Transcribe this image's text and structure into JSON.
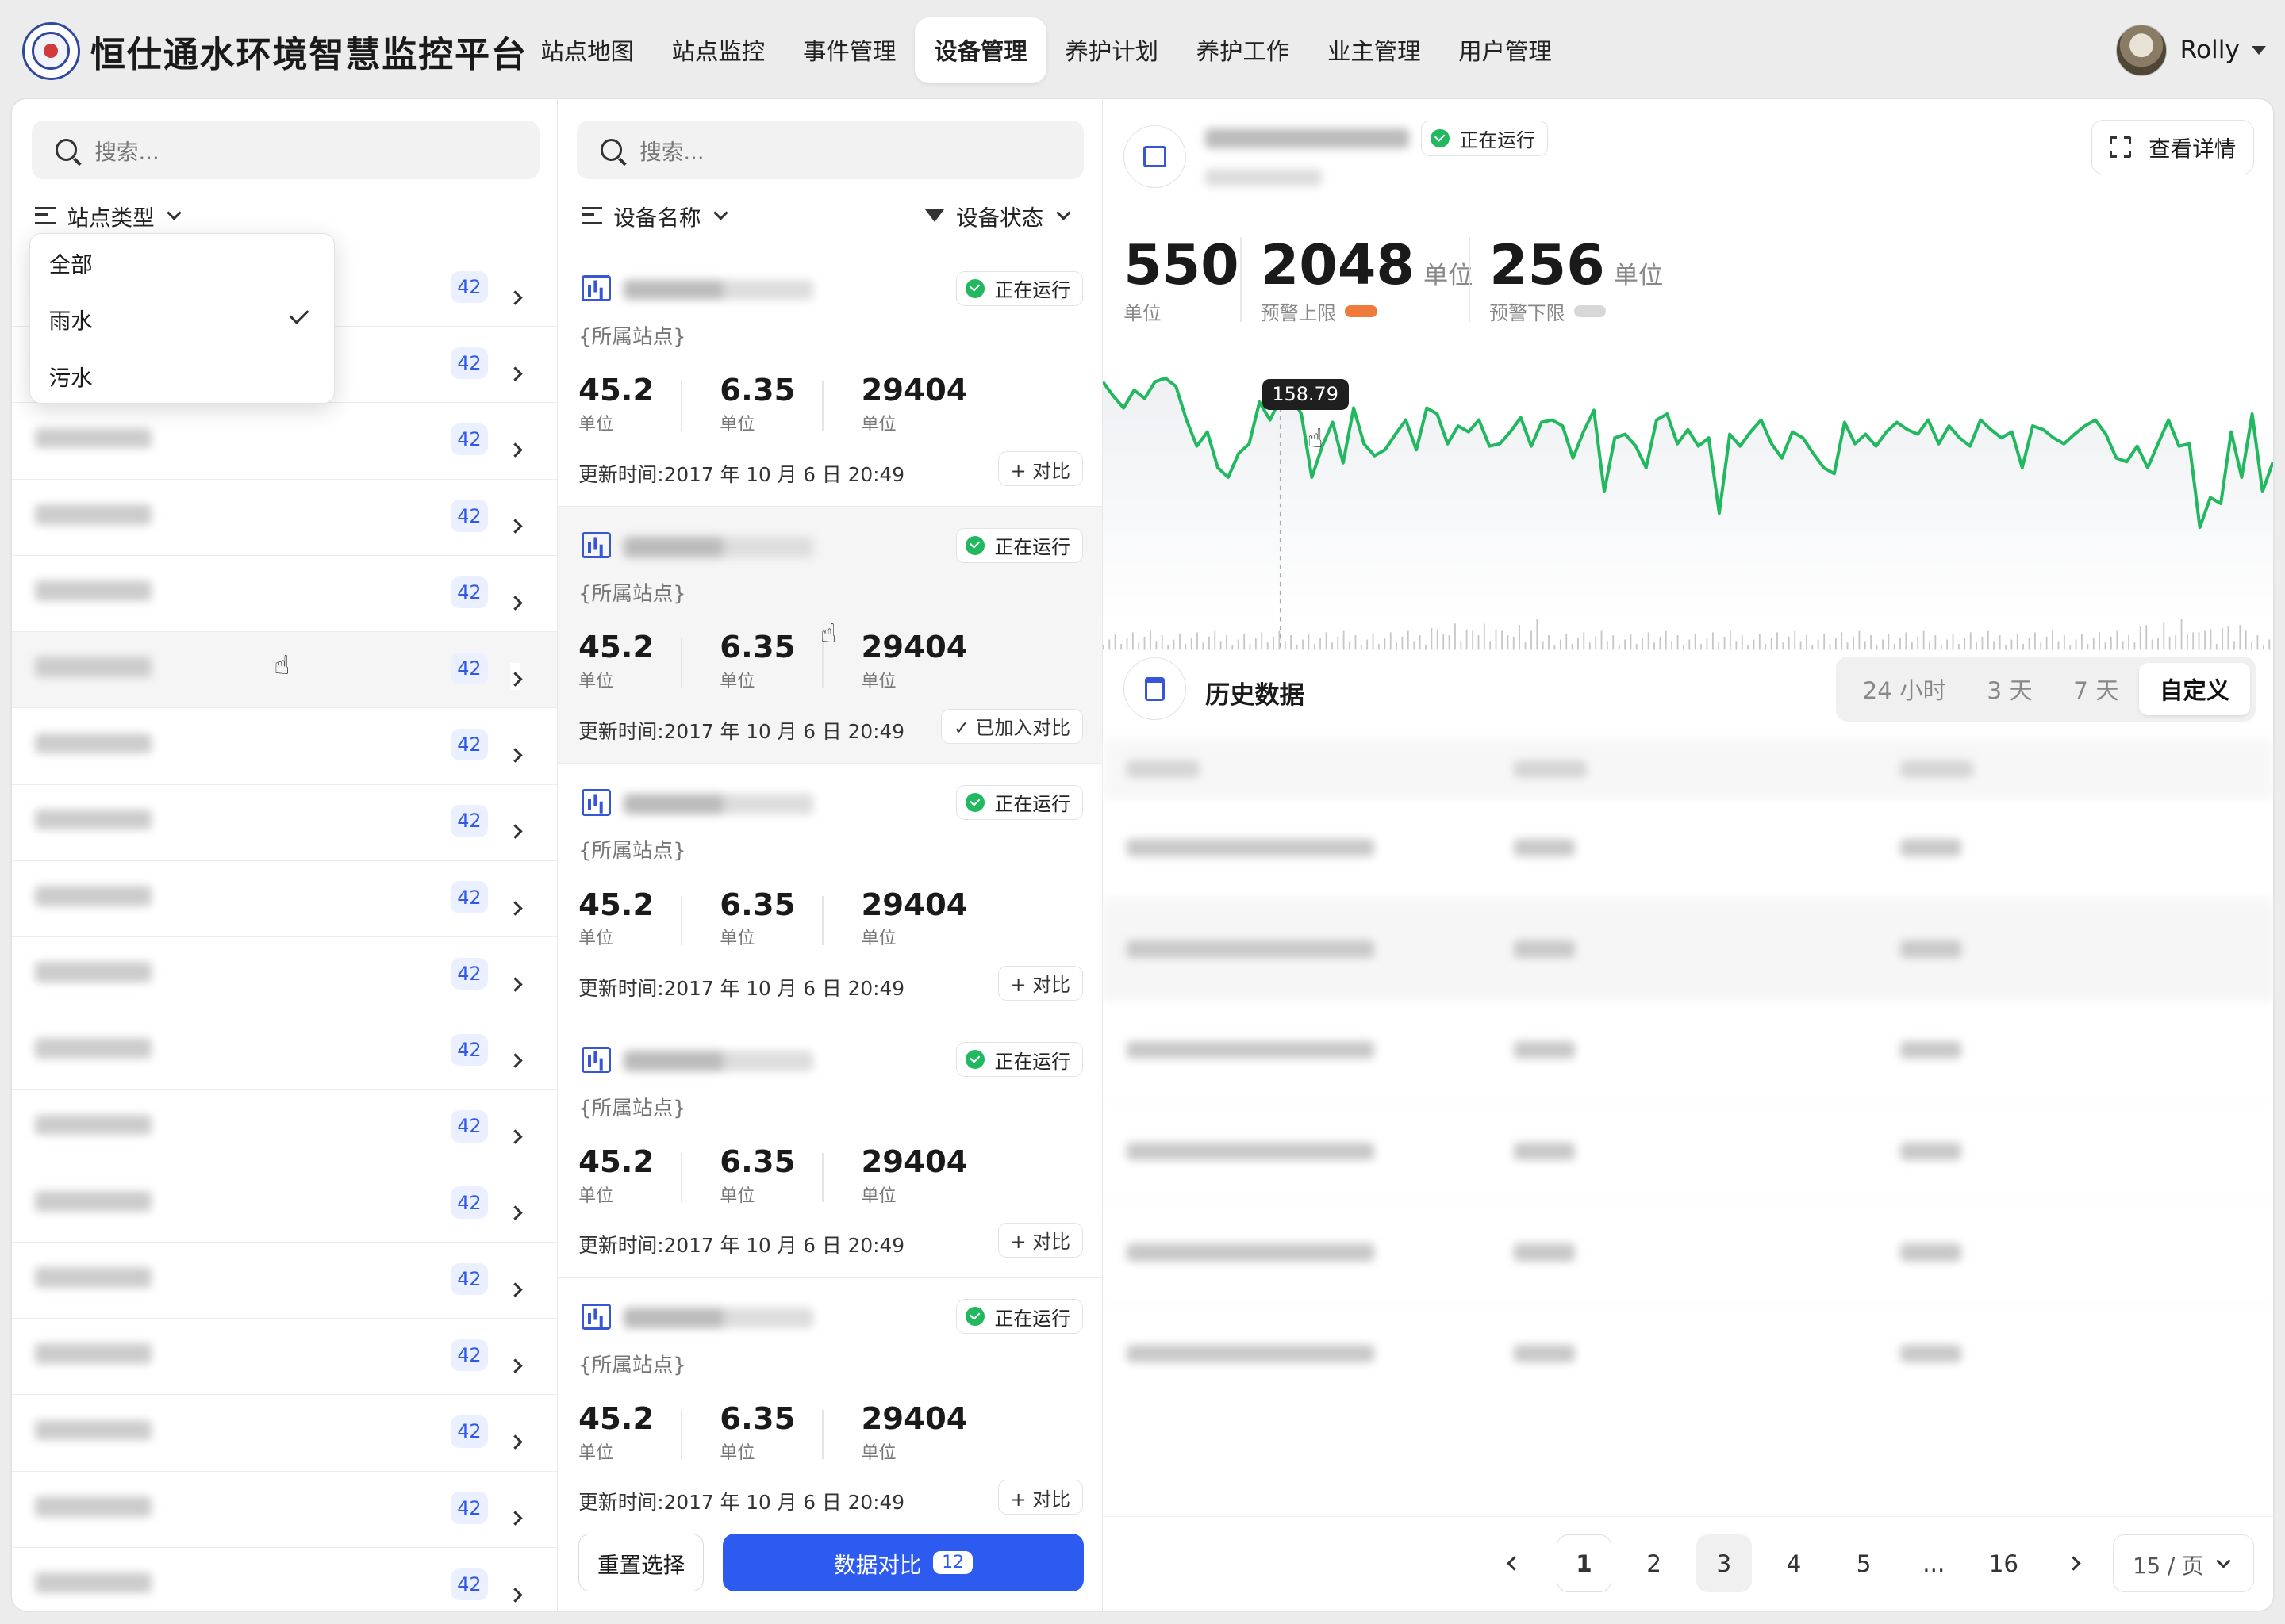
{
  "app": {
    "title": "恒仕通水环境智慧监控平台"
  },
  "nav": {
    "tabs": [
      "站点地图",
      "站点监控",
      "事件管理",
      "设备管理",
      "养护计划",
      "养护工作",
      "业主管理",
      "用户管理"
    ],
    "active": 3
  },
  "user": {
    "name": "Rolly"
  },
  "stations": {
    "search_placeholder": "搜索...",
    "sort_label": "站点类型",
    "dropdown": {
      "options": [
        "全部",
        "雨水",
        "污水"
      ],
      "selected": 1
    },
    "rows": [
      {
        "count": "42"
      },
      {
        "count": "42"
      },
      {
        "count": "42"
      },
      {
        "count": "42"
      },
      {
        "count": "42"
      },
      {
        "count": "42"
      },
      {
        "count": "42"
      },
      {
        "count": "42"
      },
      {
        "count": "42"
      },
      {
        "count": "42"
      },
      {
        "count": "42"
      },
      {
        "count": "42"
      },
      {
        "count": "42"
      },
      {
        "count": "42"
      },
      {
        "count": "42"
      },
      {
        "count": "42"
      },
      {
        "count": "42"
      },
      {
        "count": "42"
      }
    ]
  },
  "devices": {
    "search_placeholder": "搜索...",
    "sort_label": "设备名称",
    "filter_label": "设备状态",
    "cards": [
      {
        "status": "正在运行",
        "site": "{所属站点}",
        "m1": "45.2",
        "m2": "6.35",
        "m3": "29404",
        "unit": "单位",
        "updated": "更新时间:2017 年 10 月 6 日 20:49",
        "action": "+ 对比"
      },
      {
        "status": "正在运行",
        "site": "{所属站点}",
        "m1": "45.2",
        "m2": "6.35",
        "m3": "29404",
        "unit": "单位",
        "updated": "更新时间:2017 年 10 月 6 日 20:49",
        "action": "✓ 已加入对比"
      },
      {
        "status": "正在运行",
        "site": "{所属站点}",
        "m1": "45.2",
        "m2": "6.35",
        "m3": "29404",
        "unit": "单位",
        "updated": "更新时间:2017 年 10 月 6 日 20:49",
        "action": "+ 对比"
      },
      {
        "status": "正在运行",
        "site": "{所属站点}",
        "m1": "45.2",
        "m2": "6.35",
        "m3": "29404",
        "unit": "单位",
        "updated": "更新时间:2017 年 10 月 6 日 20:49",
        "action": "+ 对比"
      },
      {
        "status": "正在运行",
        "site": "{所属站点}",
        "m1": "45.2",
        "m2": "6.35",
        "m3": "29404",
        "unit": "单位",
        "updated": "更新时间:2017 年 10 月 6 日 20:49",
        "action": "+ 对比"
      }
    ],
    "reset_label": "重置选择",
    "compare_label": "数据对比",
    "compare_count": "12"
  },
  "detail": {
    "status": "正在运行",
    "view_details": "查看详情",
    "stats": [
      {
        "value": "550",
        "unit": "",
        "label": "单位"
      },
      {
        "value": "2048",
        "unit": "单位",
        "label": "预警上限",
        "color": "#f07a3c"
      },
      {
        "value": "256",
        "unit": "单位",
        "label": "预警下限",
        "color": "#d8d8d8"
      }
    ],
    "line_color": "#22b860",
    "tooltip": "158.79",
    "history_title": "历史数据",
    "ranges": [
      "24 小时",
      "3 天",
      "7 天",
      "自定义"
    ],
    "active_range": 3
  },
  "chart_data": {
    "type": "line",
    "series": [
      {
        "values": [
          172,
          160,
          150,
          165,
          158,
          172,
          175,
          168,
          140,
          118,
          130,
          100,
          92,
          112,
          120,
          155,
          140,
          158,
          160,
          145,
          92,
          118,
          138,
          104,
          150,
          120,
          110,
          115,
          128,
          140,
          115,
          150,
          145,
          120,
          135,
          130,
          140,
          118,
          120,
          130,
          142,
          118,
          138,
          140,
          135,
          108,
          130,
          148,
          80,
          125,
          128,
          118,
          100,
          140,
          145,
          120,
          132,
          118,
          125,
          62,
          128,
          118,
          130,
          140,
          120,
          108,
          130,
          125,
          112,
          100,
          95,
          138,
          120,
          128,
          118,
          130,
          138,
          132,
          128,
          140,
          120,
          135,
          125,
          118,
          140,
          132,
          125,
          130,
          100,
          135,
          132,
          125,
          120,
          128,
          135,
          140,
          128,
          108,
          105,
          118,
          100,
          120,
          140,
          118,
          120,
          50,
          75,
          70,
          130,
          92,
          145,
          80,
          105
        ]
      }
    ],
    "highlight": {
      "index": 17,
      "value": 158.79
    }
  },
  "pagination": {
    "pages": [
      "1",
      "2",
      "3",
      "4",
      "5",
      "...",
      "16"
    ],
    "current": "1",
    "page_size": "15 / 页"
  }
}
